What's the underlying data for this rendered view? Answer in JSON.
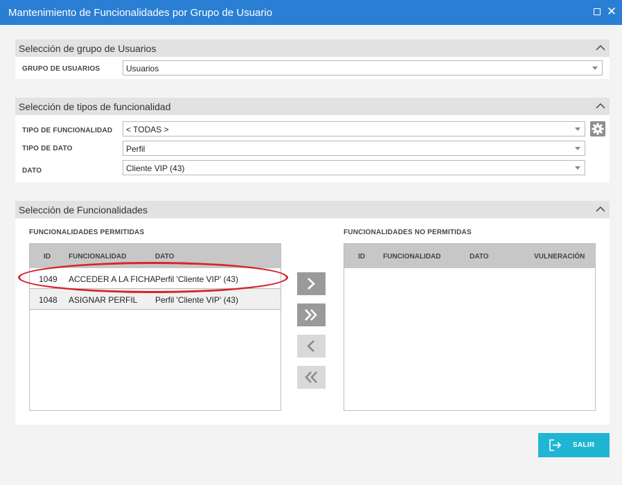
{
  "window": {
    "title": "Mantenimiento de Funcionalidades por Grupo de Usuario"
  },
  "user_group_panel": {
    "title": "Selección de grupo de Usuarios",
    "group_label": "GRUPO DE USUARIOS",
    "group_value": "Usuarios"
  },
  "type_panel": {
    "title": "Selección de tipos de funcionalidad",
    "functionality_type_label": "TIPO DE FUNCIONALIDAD",
    "functionality_type_value": "< TODAS >",
    "data_type_label": "TIPO DE DATO",
    "data_type_value": "Perfil",
    "data_label": "DATO",
    "data_value": "Cliente VIP (43)"
  },
  "functionalities_panel": {
    "title": "Selección de Funcionalidades",
    "allowed": {
      "title": "FUNCIONALIDADES PERMITIDAS",
      "columns": [
        "ID",
        "FUNCIONALIDAD",
        "DATO"
      ],
      "rows": [
        {
          "id": "1049",
          "funcionalidad": "ACCEDER A LA FICHA",
          "dato": "Perfil 'Cliente VIP' (43)"
        },
        {
          "id": "1048",
          "funcionalidad": "ASIGNAR PERFIL",
          "dato": "Perfil 'Cliente VIP' (43)"
        }
      ]
    },
    "not_allowed": {
      "title": "FUNCIONALIDADES NO PERMITIDAS",
      "columns": [
        "ID",
        "FUNCIONALIDAD",
        "DATO",
        "VULNERACIÓN"
      ],
      "rows": []
    },
    "move_buttons": [
      {
        "icon": "chevron-right-icon",
        "enabled": true
      },
      {
        "icon": "double-chevron-right-icon",
        "enabled": true
      },
      {
        "icon": "chevron-left-icon",
        "enabled": false
      },
      {
        "icon": "double-chevron-left-icon",
        "enabled": false
      }
    ]
  },
  "footer": {
    "exit_label": "SALIR",
    "exit_icon": "exit-icon"
  },
  "colors": {
    "titlebar": "#2a7fd4",
    "exit_button": "#1fb5d3",
    "highlight": "#d7242b"
  }
}
